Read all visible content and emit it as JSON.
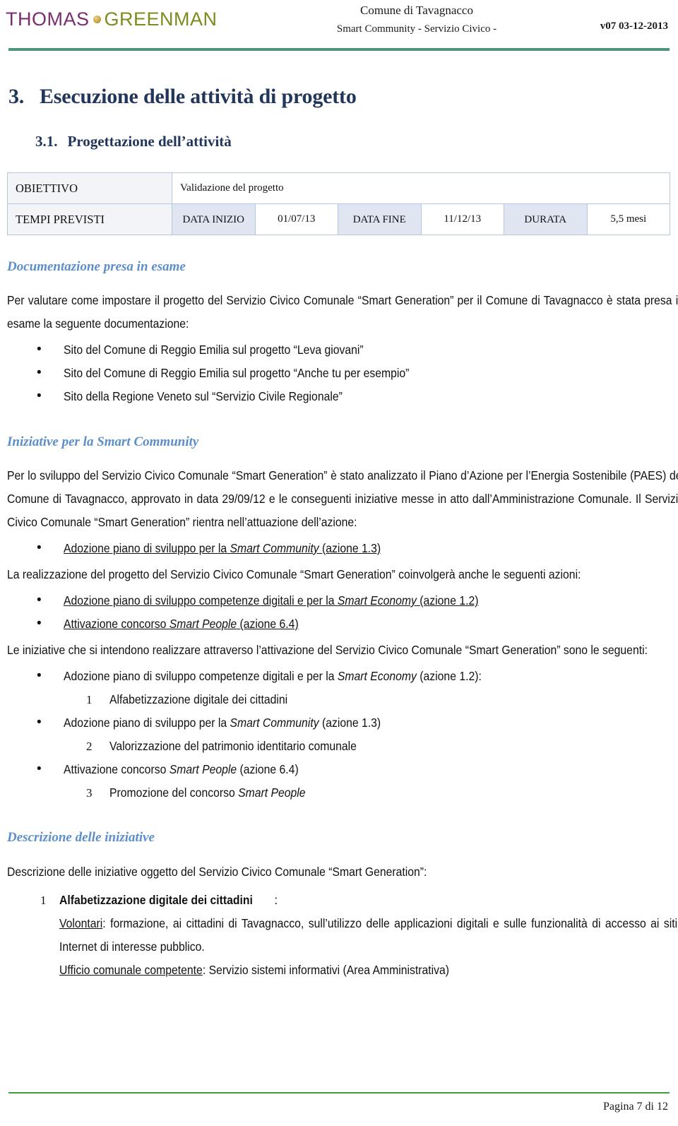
{
  "header": {
    "logo_thomas": "THOMAS",
    "logo_greenman": "GREENMAN",
    "title_line1": "Comune di Tavagnacco",
    "title_line2": "Smart Community  - Servizio Civico -",
    "version": "v07  03-12-2013",
    "rule_color": "#4f9480"
  },
  "headings": {
    "h1_number": "3.",
    "h1_text": "Esecuzione delle attività di progetto",
    "h2_number": "3.1.",
    "h2_text": "Progettazione dell’attività",
    "color": "#21365a"
  },
  "info_table": {
    "row1": {
      "label": "OBIETTIVO",
      "value": "Validazione del progetto"
    },
    "row2": {
      "label": "TEMPI PREVISTI",
      "cells": [
        {
          "kind": "header",
          "text": "DATA INIZIO"
        },
        {
          "kind": "data",
          "text": "01/07/13"
        },
        {
          "kind": "header",
          "text": "DATA FINE"
        },
        {
          "kind": "data",
          "text": "11/12/13"
        },
        {
          "kind": "header",
          "text": "DURATA"
        },
        {
          "kind": "data",
          "text": "5,5 mesi"
        }
      ]
    },
    "header_bg": "#dfe6f2",
    "label_bg": "#f2f4f7",
    "border_color": "#b5c6dd"
  },
  "sections": {
    "s1": {
      "heading": "Documentazione presa in esame",
      "paragraph": "Per valutare come impostare il progetto del Servizio Civico Comunale “Smart Generation” per il Comune di Tavagnacco è stata presa in esame la seguente documentazione:",
      "bullets": [
        "Sito del Comune di Reggio Emilia sul progetto “Leva giovani”",
        "Sito del Comune di Reggio Emilia sul progetto “Anche tu per esempio”",
        "Sito della Regione Veneto sul “Servizio Civile Regionale”"
      ]
    },
    "s2": {
      "heading": "Iniziative per la Smart Community",
      "paragraph1": "Per lo sviluppo del Servizio Civico Comunale “Smart Generation” è stato analizzato il Piano d’Azione per l’Energia Sostenibile (PAES) del Comune di Tavagnacco, approvato in data 29/09/12 e le conseguenti iniziative messe in atto dall’Amministrazione Comunale. Il Servizio Civico Comunale “Smart Generation” rientra nell’attuazione dell’azione:",
      "bullet_action": {
        "pre": "Adozione piano di sviluppo per la ",
        "italic": "Smart Community",
        "post": " (azione 1.3)"
      },
      "paragraph2": "La realizzazione del progetto del Servizio Civico Comunale “Smart Generation” coinvolgerà anche le seguenti azioni:",
      "bullets2": [
        {
          "pre": "Adozione piano di sviluppo competenze digitali e per la ",
          "italic": "Smart Economy",
          "post": " (azione 1.2)"
        },
        {
          "pre": "Attivazione concorso ",
          "italic": "Smart People",
          "post": " (azione 6.4)"
        }
      ],
      "paragraph3": "Le iniziative che si intendono realizzare attraverso l’attivazione del Servizio Civico Comunale “Smart Generation” sono le seguenti:",
      "mixed_list": [
        {
          "type": "bullet",
          "pre": "Adozione piano di sviluppo competenze digitali e per la ",
          "italic": "Smart Economy",
          "post": " (azione 1.2):"
        },
        {
          "type": "number",
          "n": "1",
          "text": "Alfabetizzazione digitale dei cittadini"
        },
        {
          "type": "bullet",
          "pre": "Adozione piano di sviluppo per la ",
          "italic": "Smart Community",
          "post": " (azione 1.3)"
        },
        {
          "type": "number",
          "n": "2",
          "text": "Valorizzazione del patrimonio identitario comunale"
        },
        {
          "type": "bullet",
          "pre": "Attivazione concorso ",
          "italic": "Smart People",
          "post": " (azione 6.4)"
        },
        {
          "type": "number",
          "n": "3",
          "pre": "Promozione del concorso ",
          "italic": "Smart People",
          "post": ""
        }
      ]
    },
    "s3": {
      "heading": "Descrizione delle iniziative",
      "paragraph": "Descrizione delle iniziative oggetto del Servizio Civico Comunale “Smart Generation”:",
      "item": {
        "n": "1",
        "title": "Alfabetizzazione digitale dei cittadini",
        "title_suffix": ":",
        "line1_label": "Volontari",
        "line1_text": ": formazione, ai cittadini di Tavagnacco, sull’utilizzo delle applicazioni digitali e sulle funzionalità di accesso ai siti Internet di interesse pubblico.",
        "line2_label": " Ufficio comunale competente",
        "line2_text": ": Servizio sistemi informativi (Area Amministrativa)"
      }
    },
    "heading_color": "#5b8ecb"
  },
  "footer": {
    "page_label": "Pagina 7 di 12",
    "rule_color": "#3f9c43"
  }
}
